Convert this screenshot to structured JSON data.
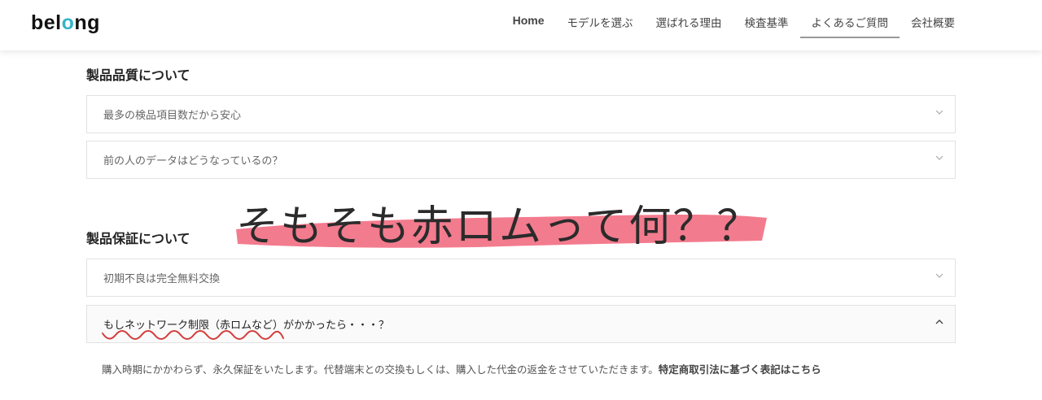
{
  "header": {
    "logo_prefix": "bel",
    "logo_accent": "o",
    "logo_suffix": "ng",
    "nav": [
      {
        "label": "Home"
      },
      {
        "label": "モデルを選ぶ"
      },
      {
        "label": "選ばれる理由"
      },
      {
        "label": "検査基準"
      },
      {
        "label": "よくあるご質問"
      },
      {
        "label": "会社概要"
      }
    ],
    "active_nav": "よくあるご質問"
  },
  "sections": [
    {
      "title": "製品品質について",
      "items": [
        {
          "question": "最多の検品項目数だから安心",
          "state": "collapsed"
        },
        {
          "question": "前の人のデータはどうなっているの？",
          "state": "collapsed"
        }
      ]
    },
    {
      "title": "製品保証について",
      "items": [
        {
          "question": "初期不良は完全無料交換",
          "state": "collapsed"
        },
        {
          "question": "もしネットワーク制限（赤ロムなど）がかかったら・・・？",
          "state": "expanded"
        }
      ]
    }
  ],
  "answer": {
    "text": "購入時期にかかわらず、永久保証をいたします。代替端末との交換もしくは、購入した代金の返金をさせていただきます。",
    "link": "特定商取引法に基づく表記はこちら"
  },
  "annotation": {
    "text": "そもそも赤ロムって何？？",
    "highlight_color": "#f0566e",
    "squiggle_color": "#d43c3c"
  },
  "colors": {
    "logo_accent": "#36b3c9",
    "border": "#e2e2e2"
  },
  "icons": {
    "collapsed": "chevron-down-icon",
    "expanded": "chevron-up-icon"
  }
}
